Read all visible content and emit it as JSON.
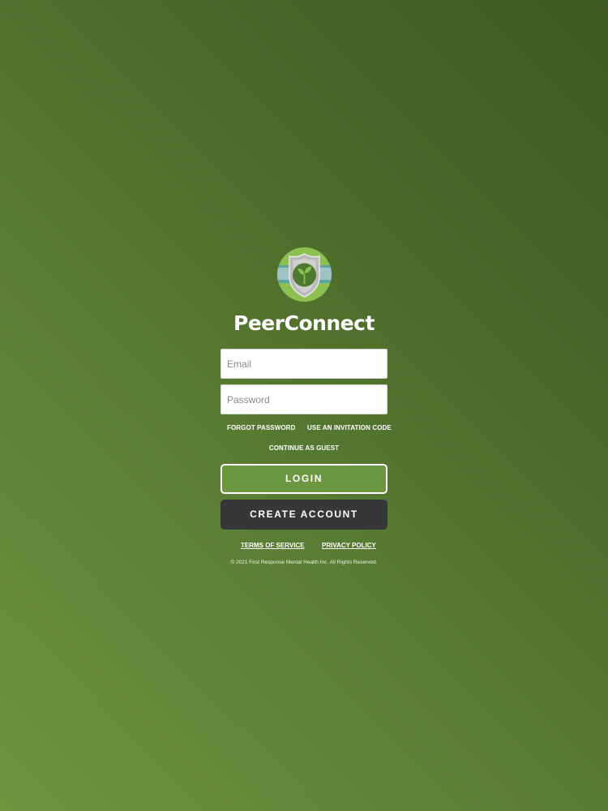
{
  "app": {
    "name": "PeerConnect",
    "logo_icon": "shield-sprout-icon"
  },
  "form": {
    "email_placeholder": "Email",
    "email_value": "",
    "password_placeholder": "Password",
    "password_value": ""
  },
  "links": {
    "forgot_password": "FORGOT PASSWORD",
    "invitation_code": "USE AN INVITATION CODE",
    "guest": "CONTINUE AS GUEST"
  },
  "buttons": {
    "login": "LOGIN",
    "create_account": "CREATE ACCOUNT"
  },
  "footer": {
    "terms": "TERMS OF SERVICE",
    "privacy": "PRIVACY POLICY",
    "copyright": "© 2021 First Response Mental Health Inc. All Rights Reserved."
  },
  "colors": {
    "background_light": "#6e943e",
    "background_dark": "#3f5a22",
    "login_button": "#6c9640",
    "create_button": "#37373a",
    "logo_green": "#8cc152",
    "logo_teal": "#5fa3a3"
  }
}
